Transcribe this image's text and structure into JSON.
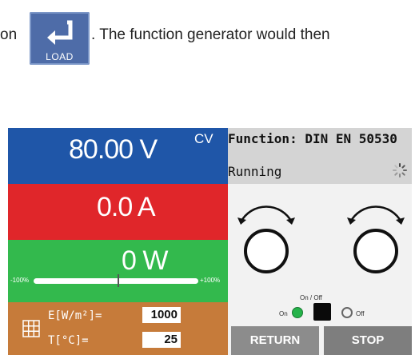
{
  "manual": {
    "text_before": "on",
    "text_after": ". The function generator would then",
    "load_button_label": "LOAD"
  },
  "screen": {
    "voltage": {
      "value": "80.00 V",
      "mode": "CV"
    },
    "current": {
      "value": "0.0 A"
    },
    "power": {
      "value": "0 W",
      "bar_min_label": "-100%",
      "bar_max_label": "+100%",
      "bar_marker_fraction": 0.5
    },
    "params": {
      "irradiance_label": "E[W/m²]=",
      "irradiance_value": "1000",
      "temperature_label": "T[°C]=",
      "temperature_value": "25"
    },
    "function": {
      "label": "Function:  DIN EN 50530",
      "status": "Running"
    },
    "onoff": {
      "title": "On / Off",
      "on_label": "On",
      "off_label": "Off",
      "state": "on"
    },
    "buttons": {
      "return_label": "RETURN",
      "stop_label": "STOP"
    }
  },
  "colors": {
    "voltage_panel": "#1f56a8",
    "current_panel": "#e0262a",
    "power_panel": "#33b94d",
    "param_panel": "#c67b3a",
    "header_gray": "#d4d4d4",
    "on_indicator": "#25b34a",
    "load_button": "#4e6ca8"
  },
  "icons": [
    "return-arrow-icon",
    "grid-icon",
    "spinner-icon",
    "rotary-knob-icon"
  ]
}
